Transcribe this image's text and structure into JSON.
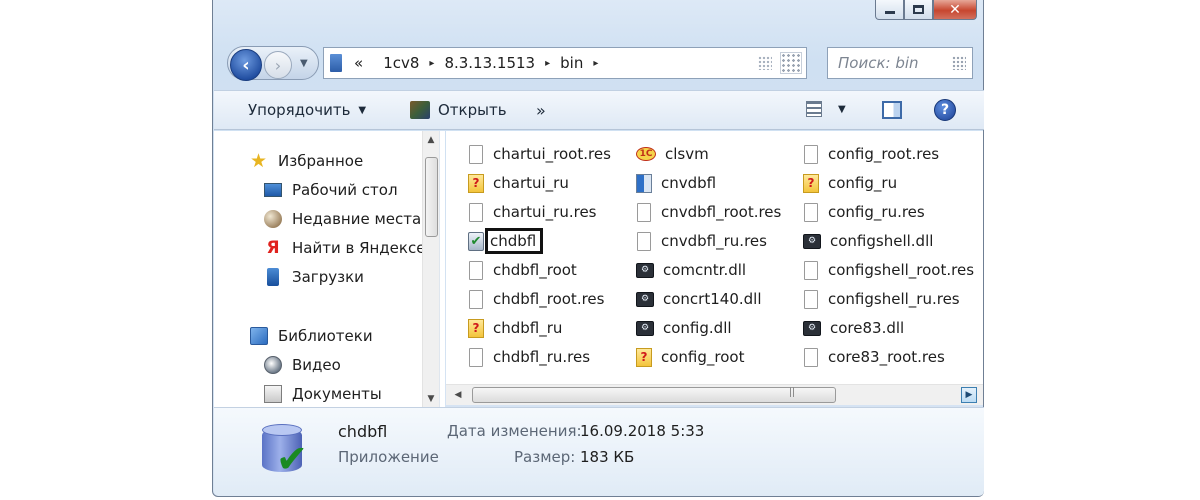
{
  "window": {
    "caption_buttons": {
      "minimize": "minimize-icon",
      "maximize": "maximize-icon",
      "close": "✕"
    }
  },
  "address": {
    "overflow": "«",
    "crumbs": [
      "1cv8",
      "8.3.13.1513",
      "bin"
    ],
    "chevron": "▸"
  },
  "search": {
    "placeholder": "Поиск: bin"
  },
  "toolbar": {
    "organize": "Упорядочить",
    "open": "Открыть",
    "more": "»"
  },
  "nav": {
    "favorites": "Избранное",
    "desktop": "Рабочий стол",
    "recent": "Недавние места",
    "yandex": "Найти в Яндексе",
    "downloads": "Загрузки",
    "libraries": "Библиотеки",
    "video": "Видео",
    "documents": "Документы"
  },
  "files": [
    {
      "name": "chartui_root.res",
      "icon": "res-file-icon"
    },
    {
      "name": "chartui_ru",
      "icon": "help-file-icon"
    },
    {
      "name": "chartui_ru.res",
      "icon": "res-file-icon"
    },
    {
      "name": "chdbfl",
      "icon": "app-check-icon",
      "selected": true
    },
    {
      "name": "chdbfl_root",
      "icon": "res-file-icon"
    },
    {
      "name": "chdbfl_root.res",
      "icon": "res-file-icon"
    },
    {
      "name": "chdbfl_ru",
      "icon": "help-file-icon"
    },
    {
      "name": "chdbfl_ru.res",
      "icon": "res-file-icon"
    },
    {
      "name": "clsvm",
      "icon": "1c-logo-icon"
    },
    {
      "name": "cnvdbfl",
      "icon": "app-window-icon"
    },
    {
      "name": "cnvdbfl_root.res",
      "icon": "res-file-icon"
    },
    {
      "name": "cnvdbfl_ru.res",
      "icon": "res-file-icon"
    },
    {
      "name": "comcntr.dll",
      "icon": "dll-file-icon"
    },
    {
      "name": "concrt140.dll",
      "icon": "dll-file-icon"
    },
    {
      "name": "config.dll",
      "icon": "dll-file-icon"
    },
    {
      "name": "config_root",
      "icon": "help-file-icon"
    },
    {
      "name": "config_root.res",
      "icon": "res-file-icon"
    },
    {
      "name": "config_ru",
      "icon": "help-file-icon"
    },
    {
      "name": "config_ru.res",
      "icon": "res-file-icon"
    },
    {
      "name": "configshell.dll",
      "icon": "dll-file-icon"
    },
    {
      "name": "configshell_root.res",
      "icon": "res-file-icon"
    },
    {
      "name": "configshell_ru.res",
      "icon": "res-file-icon"
    },
    {
      "name": "core83.dll",
      "icon": "dll-file-icon"
    },
    {
      "name": "core83_root.res",
      "icon": "res-file-icon"
    }
  ],
  "details": {
    "name": "chdbfl",
    "type": "Приложение",
    "modified_label": "Дата изменения:",
    "modified_value": "16.09.2018 5:33",
    "size_label": "Размер:",
    "size_value": "183 КБ"
  }
}
